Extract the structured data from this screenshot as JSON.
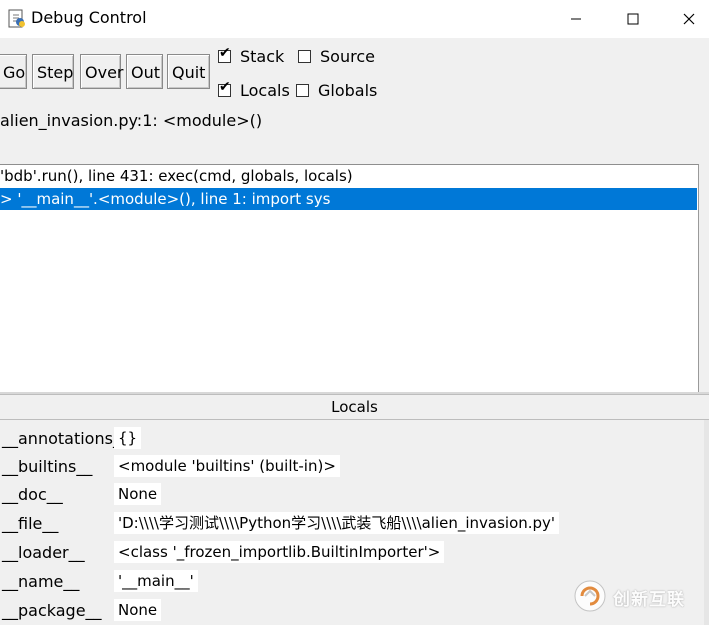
{
  "window": {
    "title": "Debug Control",
    "icon": "python-idle-icon",
    "controls": [
      "minimize-icon",
      "maximize-icon",
      "close-icon"
    ]
  },
  "toolbar": {
    "buttons": {
      "go": "Go",
      "step": "Step",
      "over": "Over",
      "out": "Out",
      "quit": "Quit"
    },
    "checkboxes": {
      "stack": {
        "label": "Stack",
        "checked": true
      },
      "source": {
        "label": "Source",
        "checked": false
      },
      "locals": {
        "label": "Locals",
        "checked": true
      },
      "globals": {
        "label": "Globals",
        "checked": false
      }
    }
  },
  "status": "alien_invasion.py:1: <module>()",
  "stack": {
    "lines": [
      "'bdb'.run(), line 431: exec(cmd, globals, locals)",
      "> '__main__'.<module>(), line 1: import sys"
    ],
    "selected_index": 1,
    "selected_color": "#0078d7"
  },
  "locals": {
    "header": "Locals",
    "rows": [
      {
        "name": "__annotations__",
        "value": "{}"
      },
      {
        "name": "__builtins__",
        "value": "<module 'builtins' (built-in)>"
      },
      {
        "name": "__doc__",
        "value": "None"
      },
      {
        "name": "__file__",
        "value": "'D:\\\\\\\\学习测试\\\\\\\\Python学习\\\\\\\\武装飞船\\\\\\\\alien_invasion.py'"
      },
      {
        "name": "__loader__",
        "value": "<class '_frozen_importlib.BuiltinImporter'>"
      },
      {
        "name": "__name__",
        "value": "'__main__'"
      },
      {
        "name": "__package__",
        "value": "None"
      }
    ]
  },
  "watermark": {
    "text": "创新互联",
    "icon": "chuangxin-logo-icon"
  }
}
